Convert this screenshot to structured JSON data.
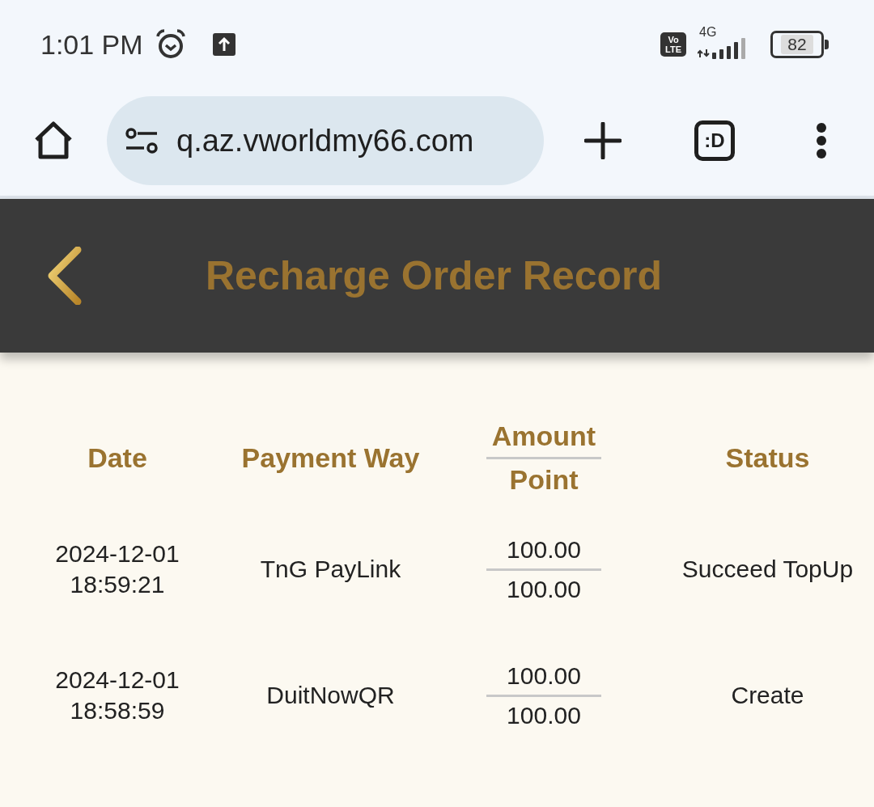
{
  "status_bar": {
    "time": "1:01 PM",
    "network_badge": "Vo LTE",
    "network_type": "4G",
    "battery": "82"
  },
  "browser": {
    "url": "q.az.vworldmy66.com",
    "tab_switcher": ":D"
  },
  "header": {
    "title": "Recharge Order Record"
  },
  "table": {
    "columns": [
      {
        "kind": "single",
        "label": "Date"
      },
      {
        "kind": "single",
        "label": "Payment Way"
      },
      {
        "kind": "split",
        "top": "Amount",
        "bottom": "Point"
      },
      {
        "kind": "single",
        "label": "Status"
      }
    ],
    "rows": [
      {
        "date": "2024-12-01 18:59:21",
        "payment_way": "TnG PayLink",
        "amount": "100.00",
        "point": "100.00",
        "status": "Succeed TopUp"
      },
      {
        "date": "2024-12-01 18:58:59",
        "payment_way": "DuitNowQR",
        "amount": "100.00",
        "point": "100.00",
        "status": "Create"
      }
    ]
  }
}
